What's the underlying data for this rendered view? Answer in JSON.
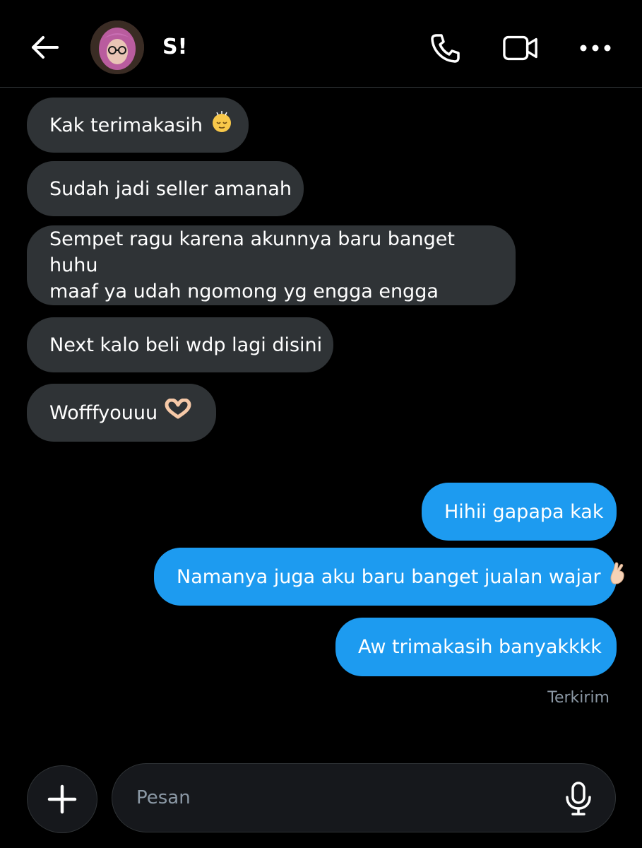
{
  "header": {
    "contact_name": "S!",
    "icons": {
      "back": "arrow-left-icon",
      "call": "phone-icon",
      "video": "video-camera-icon",
      "more": "more-horizontal-icon",
      "avatar": "avatar"
    }
  },
  "messages": [
    {
      "direction": "incoming",
      "text": "Kak terimakasih",
      "emoji": "relieved-face-icon"
    },
    {
      "direction": "incoming",
      "text": "Sudah jadi seller amanah"
    },
    {
      "direction": "incoming",
      "lines": [
        "Sempet ragu karena akunnya baru banget huhu",
        "maaf ya udah ngomong yg engga engga"
      ]
    },
    {
      "direction": "incoming",
      "text": "Next kalo beli wdp lagi disini"
    },
    {
      "direction": "incoming",
      "text": "Wofffyouuu",
      "emoji": "heart-hands-icon"
    },
    {
      "direction": "outgoing",
      "text": "Hihii gapapa kak"
    },
    {
      "direction": "outgoing",
      "text": "Namanya juga aku baru banget jualan wajar",
      "emoji": "hand-with-index-finger-and-thumb-crossed-icon"
    },
    {
      "direction": "outgoing",
      "text": "Aw trimakasih banyakkkk"
    }
  ],
  "status_text": "Terkirim",
  "composer": {
    "placeholder": "Pesan",
    "value": ""
  },
  "colors": {
    "background": "#000000",
    "incoming_bubble": "#2f3336",
    "outgoing_bubble": "#1d9bf0",
    "muted_text": "#8b98a5"
  }
}
